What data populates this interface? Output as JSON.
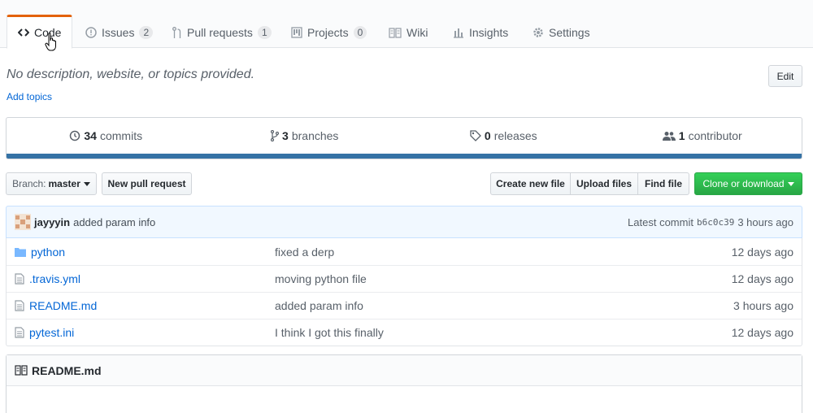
{
  "tabs": [
    {
      "label": "Code",
      "icon": "code-icon",
      "selected": true
    },
    {
      "label": "Issues",
      "icon": "issue-icon",
      "count": "2"
    },
    {
      "label": "Pull requests",
      "icon": "pull-request-icon",
      "count": "1"
    },
    {
      "label": "Projects",
      "icon": "project-icon",
      "count": "0"
    },
    {
      "label": "Wiki",
      "icon": "book-icon"
    },
    {
      "label": "Insights",
      "icon": "graph-icon"
    },
    {
      "label": "Settings",
      "icon": "gear-icon"
    }
  ],
  "repo": {
    "description": "No description, website, or topics provided.",
    "add_topics": "Add topics",
    "edit_label": "Edit"
  },
  "summary": {
    "commits_count": "34",
    "commits_label": "commits",
    "branches_count": "3",
    "branches_label": "branches",
    "releases_count": "0",
    "releases_label": "releases",
    "contributors_count": "1",
    "contributors_label": "contributor",
    "language_color": "#3572a5"
  },
  "toolbar": {
    "branch_prefix": "Branch:",
    "branch_name": "master",
    "new_pr": "New pull request",
    "create_file": "Create new file",
    "upload_files": "Upload files",
    "find_file": "Find file",
    "clone": "Clone or download"
  },
  "latest_commit": {
    "author": "jayyyin",
    "message": "added param info",
    "prefix": "Latest commit",
    "sha": "b6c0c39",
    "age": "3 hours ago"
  },
  "files": [
    {
      "type": "folder",
      "name": "python",
      "message": "fixed a derp",
      "age": "12 days ago"
    },
    {
      "type": "file",
      "name": ".travis.yml",
      "message": "moving python file",
      "age": "12 days ago"
    },
    {
      "type": "file",
      "name": "README.md",
      "message": "added param info",
      "age": "3 hours ago"
    },
    {
      "type": "file",
      "name": "pytest.ini",
      "message": "I think I got this finally",
      "age": "12 days ago"
    }
  ],
  "readme": {
    "title": "README.md"
  },
  "colors": {
    "accent_tab": "#e36209",
    "link": "#0366d6",
    "clone_green": "#28a745"
  }
}
